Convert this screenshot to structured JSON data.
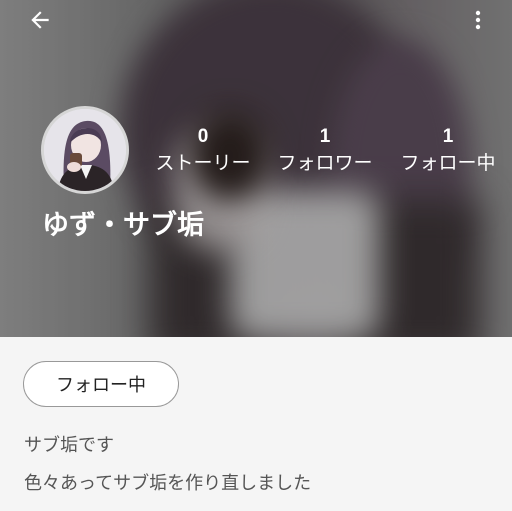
{
  "header": {
    "back_icon": "arrow-left-icon",
    "more_icon": "more-vertical-icon"
  },
  "profile": {
    "name": "ゆず・サブ垢",
    "stats": [
      {
        "value": "0",
        "label": "ストーリー"
      },
      {
        "value": "1",
        "label": "フォロワー"
      },
      {
        "value": "1",
        "label": "フォロー中"
      }
    ]
  },
  "actions": {
    "follow_label": "フォロー中"
  },
  "bio": {
    "line1": "サブ垢です",
    "line2": "色々あってサブ垢を作り直しました"
  }
}
